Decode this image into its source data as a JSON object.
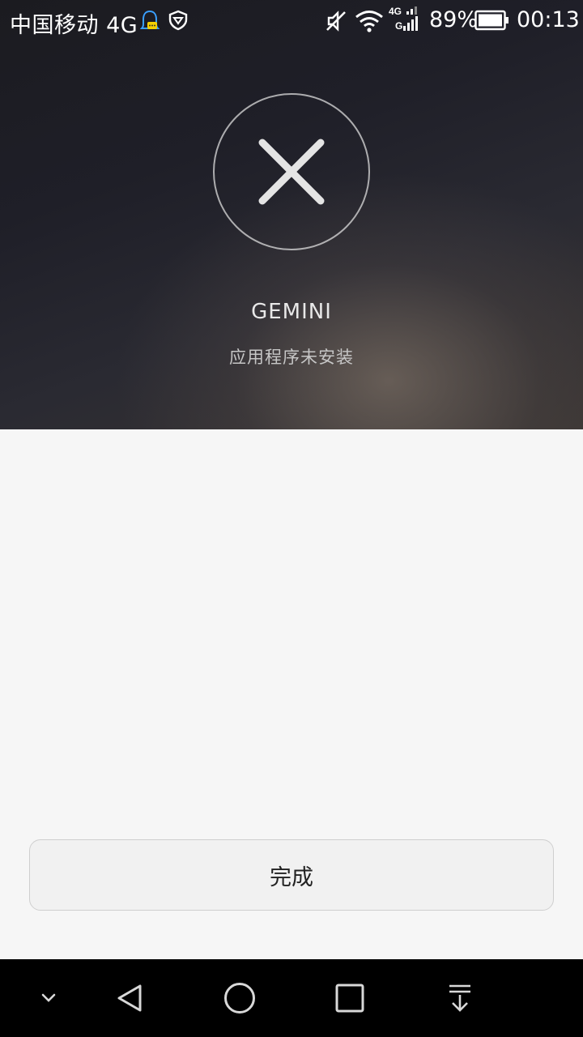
{
  "status_bar": {
    "carrier": "中国移动 4G",
    "battery_percent": "89%",
    "time": "00:13",
    "network_label_top": "4G",
    "network_label_bottom": "G",
    "icons": [
      "qq-icon",
      "shield-icon",
      "mute-icon",
      "wifi-icon",
      "signal-icon",
      "battery-icon"
    ]
  },
  "result": {
    "icon": "close-icon",
    "app_name": "GEMINI",
    "message": "应用程序未安装"
  },
  "actions": {
    "done_label": "完成"
  },
  "nav_bar": {
    "icons": [
      "chevron-down-icon",
      "back-icon",
      "home-icon",
      "recents-icon",
      "notification-pull-icon"
    ]
  },
  "colors": {
    "hero_dark": "#1f1f28",
    "content_bg": "#f6f6f6",
    "button_bg": "#f1f1f1",
    "nav_bg": "#000000"
  }
}
